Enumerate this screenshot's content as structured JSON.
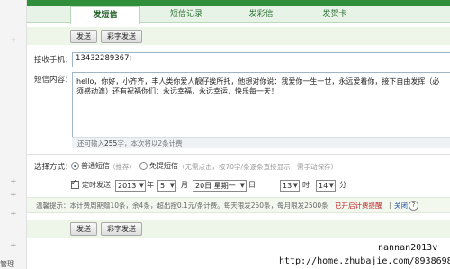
{
  "tabs": [
    "发短信",
    "短信记录",
    "发彩信",
    "发贺卡"
  ],
  "buttons": {
    "send": "发送",
    "art_send": "彩字发送"
  },
  "receiver": {
    "label": "接收手机：",
    "value": "13432289367;"
  },
  "message": {
    "label": "短信内容：",
    "text": "hello，你好，小齐齐，丰人类你爱人靓仔挨所托，他想对你说：我爱你一生一世，永远爱着你，接下自由发挥（必须感动滴）还有祝福你们：永远幸福，永远幸运，快乐每一天！",
    "counter_prefix": "还可输入",
    "counter_num": "255",
    "counter_suffix": "字，本次将以2条计费"
  },
  "method": {
    "label": "选择方式：",
    "normal": "普通短信",
    "normal_note": "（推荐）",
    "free": "免提短信",
    "free_note": "（无需点击，按70字/条逐条直接显示，需手动保存）"
  },
  "schedule": {
    "label": "定时发送",
    "year": "2013",
    "year_unit": "年",
    "month": "5",
    "month_unit": "月",
    "day": "20日 星期一",
    "day_unit": "日",
    "hour": "13",
    "hour_unit": "时",
    "minute": "14",
    "minute_unit": "分"
  },
  "reminder": {
    "prefix": "温馨提示：本计费周期赠10条，余4条，超出按0.1元/条计费。每天限发250条，每月限发2500条",
    "link_text": "已开启计费提醒",
    "sep": "|",
    "close": "关闭",
    "help": "?"
  },
  "left": {
    "plus": "+",
    "bottom_text": "管理"
  },
  "watermark": {
    "line1": "nannan2013v",
    "line2": "http://home.zhubajie.com/8938698/"
  },
  "colors": {
    "accent": "#2f8f3a",
    "link": "#1a4f9c",
    "alert": "#c0282a"
  }
}
